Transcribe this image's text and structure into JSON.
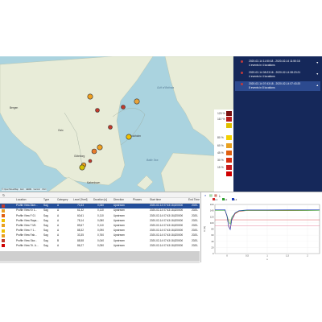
{
  "map": {
    "attribution": "© OpenStreetMap · Esri · HERE · Garmin · FAO",
    "labels": [
      {
        "name": "Bergen",
        "kind": "city"
      },
      {
        "name": "Oslo",
        "kind": "city"
      },
      {
        "name": "Stockholm",
        "kind": "city"
      },
      {
        "name": "Göteborg",
        "kind": "city"
      },
      {
        "name": "København",
        "kind": "city"
      },
      {
        "name": "Gulf of Bothnia",
        "kind": "sea"
      },
      {
        "name": "Baltic Sea",
        "kind": "sea"
      }
    ],
    "markers": [
      {
        "color": "#f0a020"
      },
      {
        "color": "#c0392b"
      },
      {
        "color": "#e8a33a"
      },
      {
        "color": "#c0392b"
      },
      {
        "color": "#c0392b"
      },
      {
        "color": "#f0c000"
      },
      {
        "color": "#f0a020"
      },
      {
        "color": "#e87a2a"
      },
      {
        "color": "#f0a020"
      },
      {
        "color": "#c0392b"
      },
      {
        "color": "#d4c000"
      }
    ],
    "legend": [
      {
        "label": "120 %",
        "color": "#7a1010"
      },
      {
        "label": "110 %",
        "color": "#b81d1d"
      },
      {
        "label": "",
        "color": "#e0c000"
      },
      {
        "label": "80 %",
        "color": "#f3d000"
      },
      {
        "label": "60 %",
        "color": "#e8a020"
      },
      {
        "label": "45 %",
        "color": "#e06010"
      },
      {
        "label": "30 %",
        "color": "#d83010"
      },
      {
        "label": "15 %",
        "color": "#c81d1d"
      },
      {
        "label": "",
        "color": "#d00000"
      }
    ]
  },
  "events": [
    {
      "line1": "2020-02-14 11:50:18 - 2020-02-14 11:50:18",
      "line2": "4 events in 4 locations",
      "selected": false
    },
    {
      "line1": "2020-02-14 08:23:16 - 2020-02-14 08:23:21",
      "line2": "4 events in 4 locations",
      "selected": false
    },
    {
      "line1": "2020-02-14 07:43:18 - 2020-02-14 07:43:20",
      "line2": "8 events in 8 locations",
      "selected": true
    }
  ],
  "table": {
    "tool_icon": "refresh-icon",
    "headers": [
      "",
      "Location",
      "Type",
      "Category",
      "Level [%ref]",
      "Duration [s]",
      "Direction",
      "Phases",
      "Start time",
      "End Time"
    ],
    "rows": [
      {
        "color": "#c0392b",
        "location": "Profile View Åker...",
        "type": "Sag",
        "category": "A",
        "level": "70,33",
        "duration": "0,060",
        "direction": "Upstream",
        "phases": "",
        "start": "2020-02-14 07:43:18,820000",
        "end": "2020-"
      },
      {
        "color": "#e8a020",
        "location": "Profile View Kr 1...",
        "type": "Sag",
        "category": "A",
        "level": "61,32",
        "duration": "0,110",
        "direction": "Upstream",
        "phases": "",
        "start": "2020-02-14 07:43:18,820000",
        "end": "2020-"
      },
      {
        "color": "#e06010",
        "location": "Profile View F 01",
        "type": "Sag",
        "category": "A",
        "level": "60,61",
        "duration": "0,110",
        "direction": "Upstream",
        "phases": "",
        "start": "2020-02-14 07:43:18,820000",
        "end": "2020-"
      },
      {
        "color": "#f0c000",
        "location": "Profile View Rapa...",
        "type": "Sag",
        "category": "A",
        "level": "78,14",
        "duration": "0,080",
        "direction": "Upstream",
        "phases": "",
        "start": "2020-02-14 07:43:18,820000",
        "end": "2020-"
      },
      {
        "color": "#e8a020",
        "location": "Profile View T M1",
        "type": "Sag",
        "category": "A",
        "level": "89,67",
        "duration": "0,110",
        "direction": "Upstream",
        "phases": "",
        "start": "2020-02-14 07:43:18,820000",
        "end": "2020-"
      },
      {
        "color": "#f0c000",
        "location": "Profile View Y 1...",
        "type": "Sag",
        "category": "A",
        "level": "88,32",
        "duration": "0,090",
        "direction": "Upstream",
        "phases": "",
        "start": "2020-02-14 07:43:18,820000",
        "end": "2020-"
      },
      {
        "color": "#e8a020",
        "location": "Profile View Fab...",
        "type": "Sag",
        "category": "A",
        "level": "33,35",
        "duration": "0,760",
        "direction": "Upstream",
        "phases": "",
        "start": "2020-02-14 07:43:18,820000",
        "end": "2020-"
      },
      {
        "color": "#c0392b",
        "location": "Profile View Stor...",
        "type": "Sag",
        "category": "B",
        "level": "88,58",
        "duration": "0,040",
        "direction": "Upstream",
        "phases": "",
        "start": "2020-02-14 07:43:18,820000",
        "end": "2020-"
      },
      {
        "color": "#d00000",
        "location": "Profile View Tri. A...",
        "type": "Sag",
        "category": "A",
        "level": "86,27",
        "duration": "0,050",
        "direction": "Upstream",
        "phases": "",
        "start": "2020-02-14 07:43:18,820000",
        "end": "2020-"
      }
    ]
  },
  "plot": {
    "toolbar_icons": [
      "zoom-icon",
      "chart-icon",
      "table-icon",
      "export-icon"
    ],
    "legend": [
      {
        "name": "L1",
        "color": "#d62728"
      },
      {
        "name": "L2",
        "color": "#2ca02c"
      },
      {
        "name": "L3",
        "color": "#1f3fbf"
      }
    ]
  },
  "chart_data": {
    "type": "line",
    "xlabel": "s",
    "ylabel": "U [%]",
    "xlim": [
      -0.3,
      2.3
    ],
    "ylim": [
      0,
      160
    ],
    "x_ticks": [
      "0",
      "0,5",
      "1",
      "1,5",
      "2"
    ],
    "y_ticks": [
      "0",
      "20",
      "40",
      "60",
      "80",
      "100",
      "120",
      "140",
      "160"
    ],
    "series": [
      {
        "name": "L1",
        "color": "#d62728",
        "x": [
          -0.3,
          -0.05,
          0.0,
          0.04,
          0.08,
          0.12,
          0.2,
          0.3,
          0.5,
          1.0,
          2.3
        ],
        "y": [
          141,
          141,
          121,
          90,
          80,
          110,
          130,
          138,
          140,
          140,
          141
        ]
      },
      {
        "name": "L2",
        "color": "#2ca02c",
        "x": [
          -0.3,
          -0.05,
          0.0,
          0.04,
          0.08,
          0.12,
          0.2,
          0.3,
          0.5,
          1.0,
          2.3
        ],
        "y": [
          141,
          141,
          124,
          105,
          96,
          118,
          132,
          139,
          140,
          140,
          141
        ]
      },
      {
        "name": "L3",
        "color": "#1f3fbf",
        "x": [
          -0.3,
          -0.05,
          0.0,
          0.04,
          0.08,
          0.12,
          0.2,
          0.3,
          0.5,
          1.0,
          2.3
        ],
        "y": [
          143,
          143,
          122,
          88,
          78,
          112,
          133,
          140,
          142,
          142,
          143
        ]
      }
    ],
    "reference_lines": [
      {
        "y": 110,
        "color": "#d62728"
      },
      {
        "y": 90,
        "color": "#e06080"
      }
    ]
  }
}
